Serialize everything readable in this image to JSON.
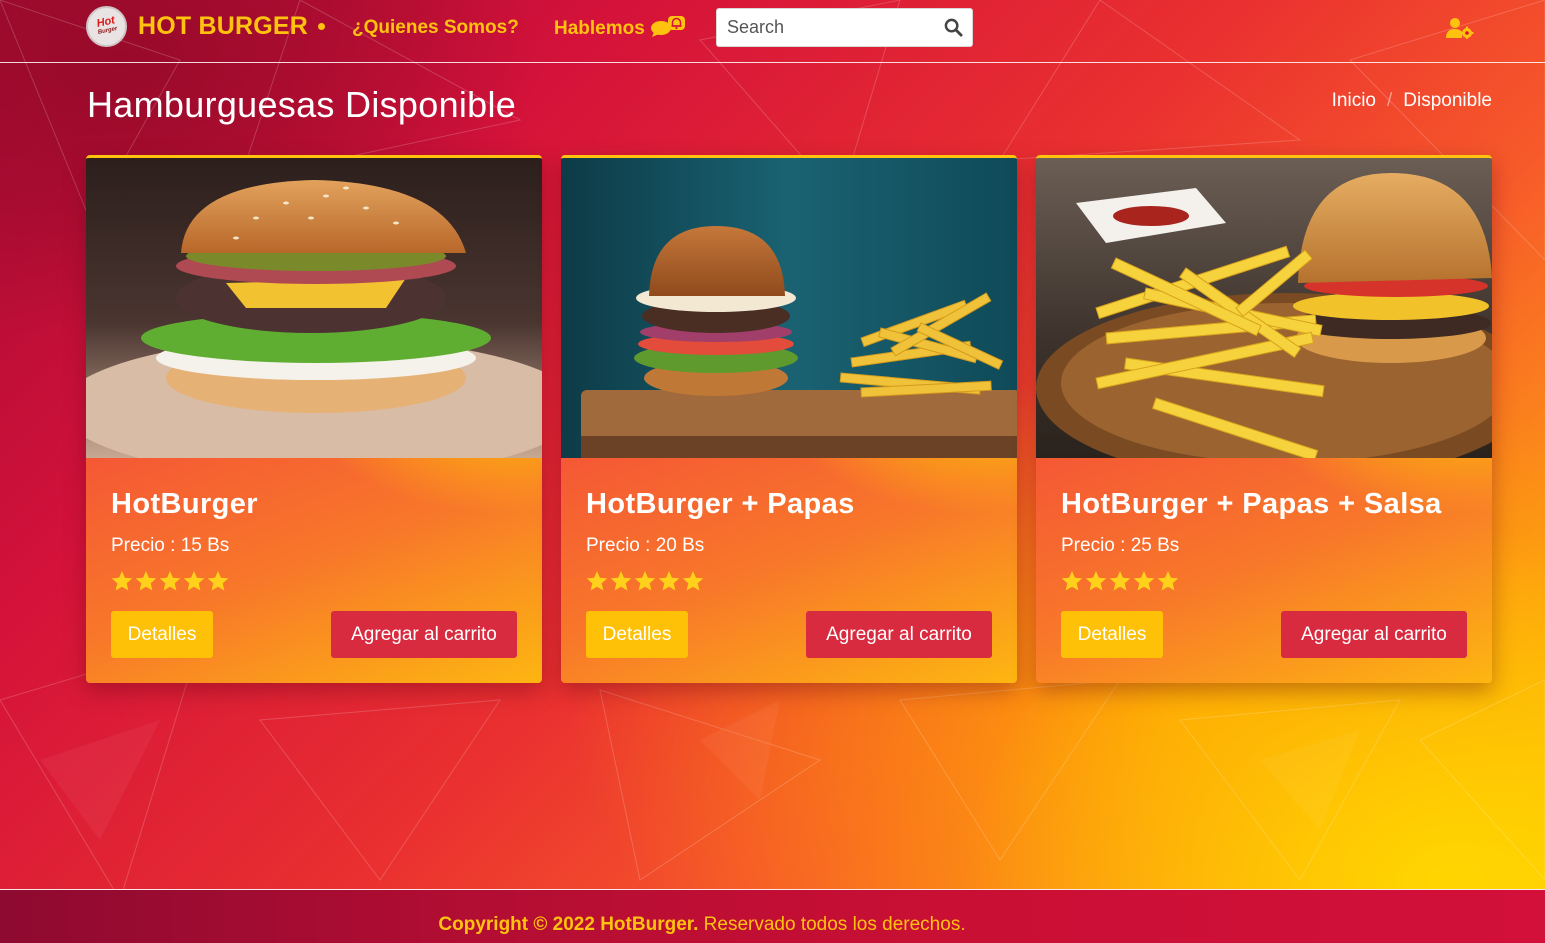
{
  "navbar": {
    "brand_name": "HOT BURGER",
    "logo_text": "Hot",
    "logo_subtext": "Burger",
    "links": {
      "quienes": "¿Quienes Somos?",
      "hablemos": "Hablemos"
    },
    "search": {
      "placeholder": "Search",
      "value": ""
    },
    "icons": {
      "search": "search-icon",
      "chat": "comments-bell-icon",
      "user": "user-gear-icon"
    }
  },
  "page": {
    "title": "Hamburguesas Disponible",
    "breadcrumb": [
      "Inicio",
      "Disponible"
    ]
  },
  "products": [
    {
      "name": "HotBurger",
      "price_label": "Precio : 15 Bs",
      "rating": 5,
      "details_label": "Detalles",
      "cart_label": "Agregar al carrito"
    },
    {
      "name": "HotBurger + Papas",
      "price_label": "Precio : 20 Bs",
      "rating": 5,
      "details_label": "Detalles",
      "cart_label": "Agregar al carrito"
    },
    {
      "name": "HotBurger + Papas + Salsa",
      "price_label": "Precio : 25 Bs",
      "rating": 5,
      "details_label": "Detalles",
      "cart_label": "Agregar al carrito"
    }
  ],
  "footer": {
    "bold": "Copyright © 2022 HotBurger.",
    "rest": " Reservado todos los derechos."
  },
  "colors": {
    "accent_yellow": "#ffc20e",
    "cart_button": "#d92b40",
    "details_button": "#ffc107",
    "bg_red": "#d4123a"
  }
}
